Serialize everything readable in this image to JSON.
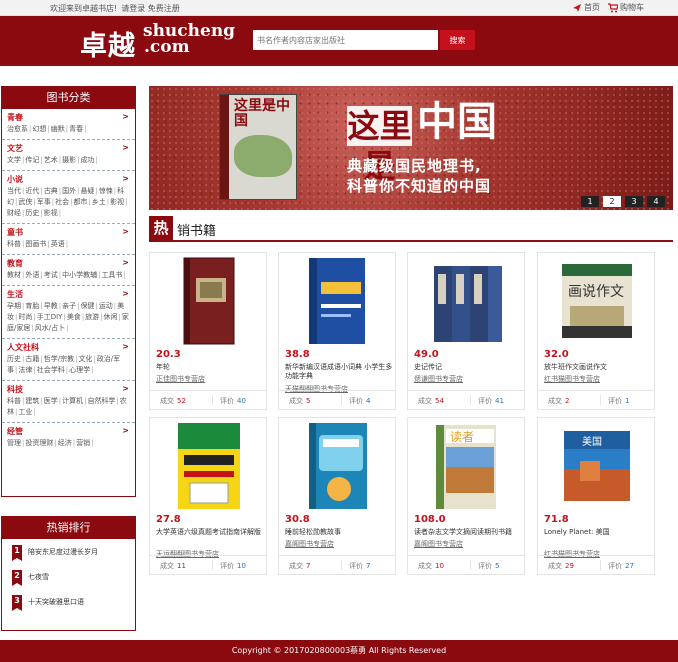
{
  "topbar": {
    "welcome": "欢迎来到卓越书店!",
    "login": "请登录",
    "register": "免费注册",
    "home": "首页",
    "cart": "购物车"
  },
  "header": {
    "logo_cn": "卓越",
    "logo_en_1": "shucheng",
    "logo_en_2": ".com",
    "search_placeholder": "书名作者内容店家出版社",
    "search_button": "搜索"
  },
  "sidebar": {
    "title": "图书分类",
    "arrow": ">",
    "categories": [
      {
        "name": "青春",
        "items": [
          "治愈系",
          "幻想",
          "幽默",
          "青春"
        ]
      },
      {
        "name": "文艺",
        "items": [
          "文学",
          "传记",
          "艺术",
          "摄影",
          "成功"
        ]
      },
      {
        "name": "小说",
        "items": [
          "当代",
          "近代",
          "古典",
          "国外",
          "悬疑",
          "惊悚",
          "科幻",
          "武侠",
          "军事",
          "社会",
          "都市",
          "乡土",
          "影视",
          "财经",
          "历史",
          "影视"
        ]
      },
      {
        "name": "童书",
        "items": [
          "科普",
          "图画书",
          "英语"
        ]
      },
      {
        "name": "教育",
        "items": [
          "教材",
          "外语",
          "考试",
          "中小学教辅",
          "工具书"
        ]
      },
      {
        "name": "生活",
        "items": [
          "孕期",
          "育胎",
          "早教",
          "亲子",
          "保健",
          "运动",
          "美妆",
          "时尚",
          "手工DIY",
          "美食",
          "旅游",
          "休闲",
          "家庭/家居",
          "风水/占卜"
        ]
      },
      {
        "name": "人文社科",
        "items": [
          "历史",
          "古籍",
          "哲学/宗教",
          "文化",
          "政治/军事",
          "法律",
          "社会学科",
          "心理学"
        ]
      },
      {
        "name": "科技",
        "items": [
          "科普",
          "建筑",
          "医学",
          "计算机",
          "自然科学",
          "农林",
          "工业"
        ]
      },
      {
        "name": "经管",
        "items": [
          "管理",
          "投资理财",
          "经济",
          "营销"
        ]
      }
    ]
  },
  "ranking": {
    "title": "热销排行",
    "items": [
      {
        "num": "1",
        "title": "陪安东尼度过漫长岁月"
      },
      {
        "num": "2",
        "title": "七夜雪"
      },
      {
        "num": "3",
        "title": "十天突破雅思口语"
      }
    ]
  },
  "banner": {
    "line1a": "这里是",
    "line1b": "中国",
    "line2": "典藏级国民地理书,",
    "line3": "科普你不知道的中国",
    "book_title": "这里是中国",
    "pages": [
      "1",
      "2",
      "3",
      "4"
    ],
    "active_page": "2"
  },
  "hot": {
    "icon": "热",
    "title": "销书籍",
    "sold_label": "成交",
    "review_label": "评价",
    "books": [
      {
        "price": "20.3",
        "title": "年轮",
        "shop": "正佳图书专营店",
        "sold": "52",
        "reviews": "40"
      },
      {
        "price": "38.8",
        "title": "新华新编汉语成语小词典 小学生多功能字典",
        "shop": "天猫翻翻图书专营店",
        "sold": "5",
        "reviews": "4"
      },
      {
        "price": "49.0",
        "title": "史记传记",
        "shop": "偲谦图书专营店",
        "sold": "54",
        "reviews": "41"
      },
      {
        "price": "32.0",
        "title": "放牛班作文画说作文",
        "shop": "红书猫图书专营店",
        "sold": "2",
        "reviews": "1"
      },
      {
        "price": "27.8",
        "title": "大学英语六级真题考试指南详解版",
        "shop": "天运翻翻图书专营店",
        "sold": "11",
        "reviews": "10"
      },
      {
        "price": "30.8",
        "title": "睡前轻松勋教故事",
        "shop": "嘉阁图书专营店",
        "sold": "7",
        "reviews": "7"
      },
      {
        "price": "108.0",
        "title": "读者杂志文学文摘阅读期刊书籍",
        "shop": "嘉阁图书专营店",
        "sold": "10",
        "reviews": "5"
      },
      {
        "price": "71.8",
        "title": "Lonely Planet: 美国",
        "shop": "红书猫图书专营店",
        "sold": "29",
        "reviews": "27"
      }
    ]
  },
  "footer": {
    "text": "Copyright © 2017020800003蔡勇 All Rights Reserved"
  },
  "colors": {
    "brand": "#8a0a10",
    "accent": "#c3121b",
    "link_blue": "#2a6fc0"
  }
}
